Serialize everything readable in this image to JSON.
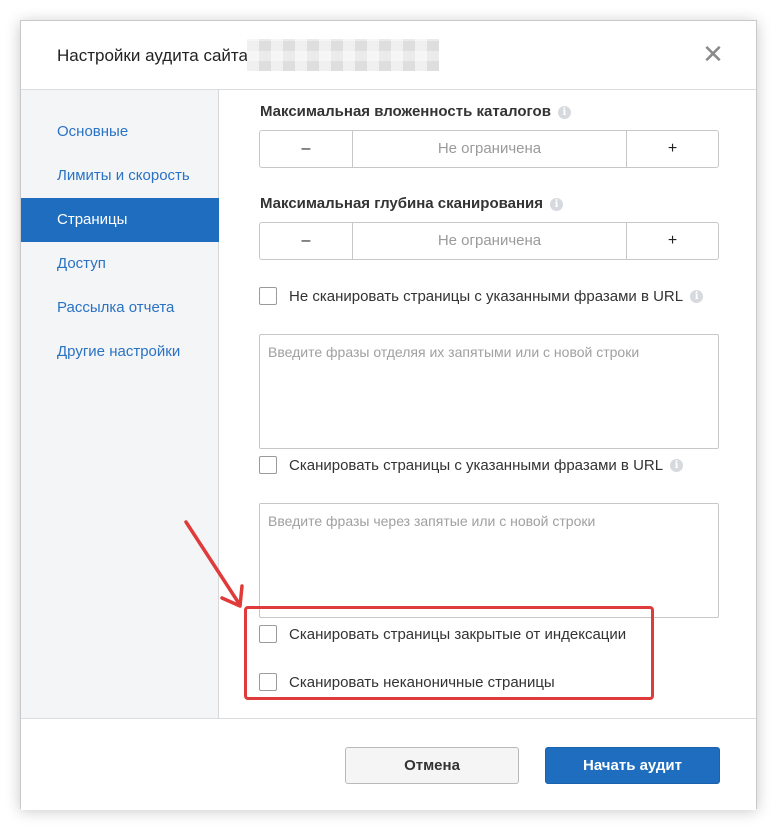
{
  "dialog": {
    "title": "Настройки аудита сайта",
    "close_icon": "✕"
  },
  "sidebar": {
    "items": [
      {
        "label": "Основные",
        "active": false
      },
      {
        "label": "Лимиты и скорость",
        "active": false
      },
      {
        "label": "Страницы",
        "active": true
      },
      {
        "label": "Доступ",
        "active": false
      },
      {
        "label": "Рассылка отчета",
        "active": false
      },
      {
        "label": "Другие настройки",
        "active": false
      }
    ]
  },
  "content": {
    "max_nesting": {
      "label": "Максимальная вложенность каталогов",
      "minus": "–",
      "value": "Не ограничена",
      "plus": "+"
    },
    "max_depth": {
      "label": "Максимальная глубина сканирования",
      "minus": "–",
      "value": "Не ограничена",
      "plus": "+"
    },
    "exclude_url": {
      "label": "Не сканировать страницы с указанными фразами в URL",
      "checked": false,
      "placeholder": "Введите фразы отделяя их запятыми или с новой строки"
    },
    "include_url": {
      "label": "Сканировать страницы с указанными фразами в URL",
      "checked": false,
      "placeholder": "Введите фразы через запятые или с новой строки"
    },
    "closed_from_index": {
      "label": "Сканировать страницы закрытые от индексации",
      "checked": false
    },
    "non_canonical": {
      "label": "Сканировать неканоничные страницы",
      "checked": false
    },
    "info_icon": "i"
  },
  "footer": {
    "cancel_label": "Отмена",
    "start_label": "Начать аудит"
  },
  "colors": {
    "accent": "#1f6dbf",
    "highlight": "#e03b3b",
    "link": "#2a72c3"
  }
}
